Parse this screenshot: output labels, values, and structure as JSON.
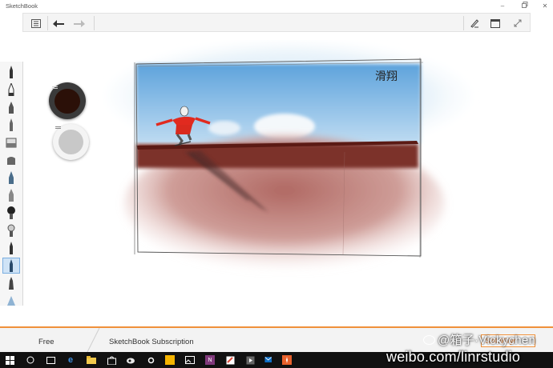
{
  "app": {
    "title": "SketchBook"
  },
  "bottom_bar": {
    "tab_free": "Free",
    "tab_subscription": "SketchBook Subscription",
    "price": "$24.99/yr"
  },
  "drawing": {
    "signature": "滑翔"
  },
  "watermark": {
    "line1": "@箱子·Vickychen",
    "line2": "weibo.com/linrstudio"
  },
  "colors": {
    "accent": "#f0913a",
    "primary_puck": "#2b1008",
    "secondary_puck": "#c8c8c8",
    "selected_tool": "#cfe3f6"
  },
  "icons": [
    "layout-icon",
    "undo-icon",
    "redo-icon",
    "pen-settings-icon",
    "window-icon",
    "fullscreen-icon",
    "minimize-icon",
    "restore-icon",
    "close-icon"
  ]
}
